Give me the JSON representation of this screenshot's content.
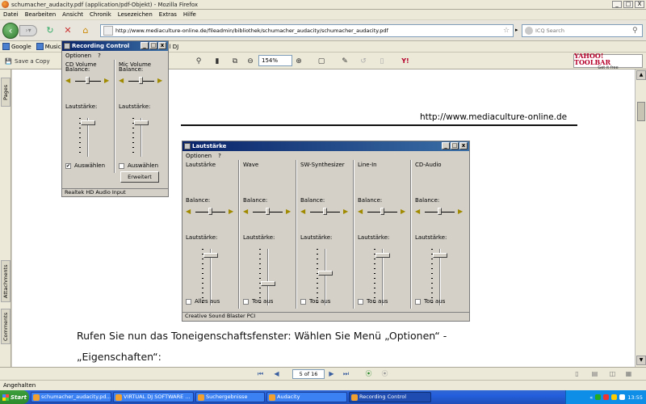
{
  "window": {
    "title": "schumacher_audacity.pdf (application/pdf-Objekt) - Mozilla Firefox",
    "controls": [
      "_",
      "□",
      "X"
    ]
  },
  "menubar": [
    "Datei",
    "Bearbeiten",
    "Ansicht",
    "Chronik",
    "Lesezeichen",
    "Extras",
    "Hilfe"
  ],
  "navbar": {
    "url": "http://www.mediaculture-online.de/fileadmin/bibliothek/schumacher_audacity/schumacher_audacity.pdf",
    "search_placeholder": "ICQ Search"
  },
  "bookmarks": [
    "Google",
    "Music B",
    "Virtual DJ"
  ],
  "pdf_toolbar": {
    "save_label": "Save a Copy",
    "zoom": "154%",
    "yahoo_line1": "YAHOO! TOOLBAR",
    "yahoo_line2": "Get it free",
    "yahoo_icon": "Y!"
  },
  "left_tabs": [
    "Pages",
    "Attachments",
    "Comments"
  ],
  "document": {
    "header_url": "http://www.mediaculture-online.de",
    "paragraph_line1": "Rufen Sie nun das Toneigenschaftsfenster: Wählen Sie Menü „Optionen“ -",
    "paragraph_line2": "„Eigenschaften“:"
  },
  "lautstaerke": {
    "title": "Lautstärke",
    "menu": [
      "Optionen",
      "?"
    ],
    "balance_label": "Balance:",
    "volume_label": "Lautstärke:",
    "channels": [
      {
        "name": "Lautstärke",
        "checkbox": "Alles aus",
        "level": 0.92
      },
      {
        "name": "Wave",
        "checkbox": "Ton aus",
        "level": 0.38
      },
      {
        "name": "SW-Synthesizer",
        "checkbox": "Ton aus",
        "level": 0.58
      },
      {
        "name": "Line-In",
        "checkbox": "Ton aus",
        "level": 0.92
      },
      {
        "name": "CD-Audio",
        "checkbox": "Ton aus",
        "level": 0.92
      }
    ],
    "status": "Creative Sound Blaster PCI"
  },
  "recording": {
    "title": "Recording Control",
    "menu": [
      "Optionen",
      "?"
    ],
    "balance_label": "Balance:",
    "volume_label": "Lautstärke:",
    "channels": [
      {
        "name": "CD Volume",
        "checkbox": "Auswählen",
        "checked": true,
        "level": 0.92
      },
      {
        "name": "Mic Volume",
        "checkbox": "Auswählen",
        "checked": false,
        "level": 0.92
      }
    ],
    "advanced_button": "Erweitert",
    "status": "Realtek HD Audio Input"
  },
  "page_nav": {
    "page": "5 of 16"
  },
  "statusbar": "Angehalten",
  "taskbar": {
    "start": "Start",
    "tasks": [
      {
        "label": "schumacher_audacity.pd...",
        "active": false
      },
      {
        "label": "VIRTUAL DJ SOFTWARE ...",
        "active": false
      },
      {
        "label": "Suchergebnisse",
        "active": false
      },
      {
        "label": "Audacity",
        "active": false
      },
      {
        "label": "Recording Control",
        "active": true
      }
    ],
    "clock": "13:55"
  }
}
